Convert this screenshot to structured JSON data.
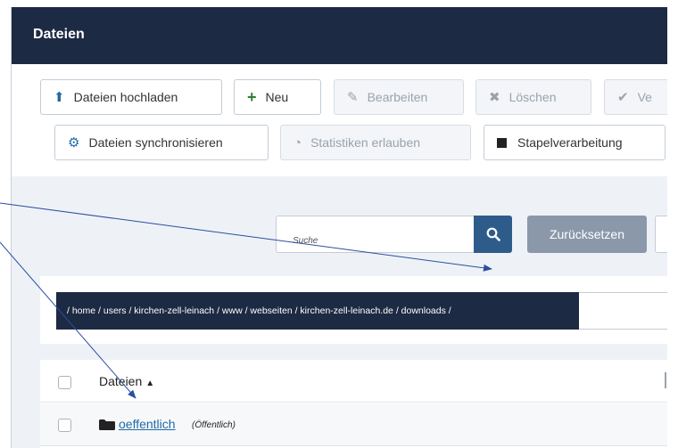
{
  "window": {
    "title": "Dateien"
  },
  "toolbar": {
    "upload_label": "Dateien hochladen",
    "new_label": "Neu",
    "edit_label": "Bearbeiten",
    "delete_label": "Löschen",
    "ve_label": "Ve",
    "sync_label": "Dateien synchronisieren",
    "stats_label": "Statistiken erlauben",
    "batch_label": "Stapelverarbeitung"
  },
  "search": {
    "placeholder": "Suche",
    "reset_label": "Zurücksetzen"
  },
  "path": {
    "value": "/ home / users / kirchen-zell-leinach / www / webseiten / kirchen-zell-leinach.de / downloads /"
  },
  "table": {
    "header": "Dateien",
    "sort_indicator": "▲",
    "rows": [
      {
        "name": "oeffentlich",
        "note": "(Öffentlich)"
      }
    ]
  },
  "colors": {
    "header_bg": "#1d2a43",
    "link": "#1e6aa8",
    "search_button": "#2e5c8a",
    "reset_button": "#8a98aa",
    "annotation_arrow": "#2b4ea1"
  }
}
